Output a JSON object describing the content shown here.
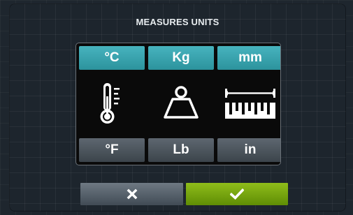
{
  "dialog": {
    "title": "MEASURES UNITS"
  },
  "units": {
    "temperature": {
      "selected_label": "°C",
      "alternate_label": "°F",
      "icon": "thermometer-icon"
    },
    "weight": {
      "selected_label": "Kg",
      "alternate_label": "Lb",
      "icon": "weight-icon"
    },
    "length": {
      "selected_label": "mm",
      "alternate_label": "in",
      "icon": "ruler-icon"
    }
  },
  "actions": {
    "cancel_icon": "close-icon",
    "confirm_icon": "checkmark-icon"
  },
  "colors": {
    "selected": "#35a3ad",
    "unselected": "#4a535b",
    "confirm": "#76a70f",
    "cancel": "#56616b",
    "background": "#1e262e"
  }
}
